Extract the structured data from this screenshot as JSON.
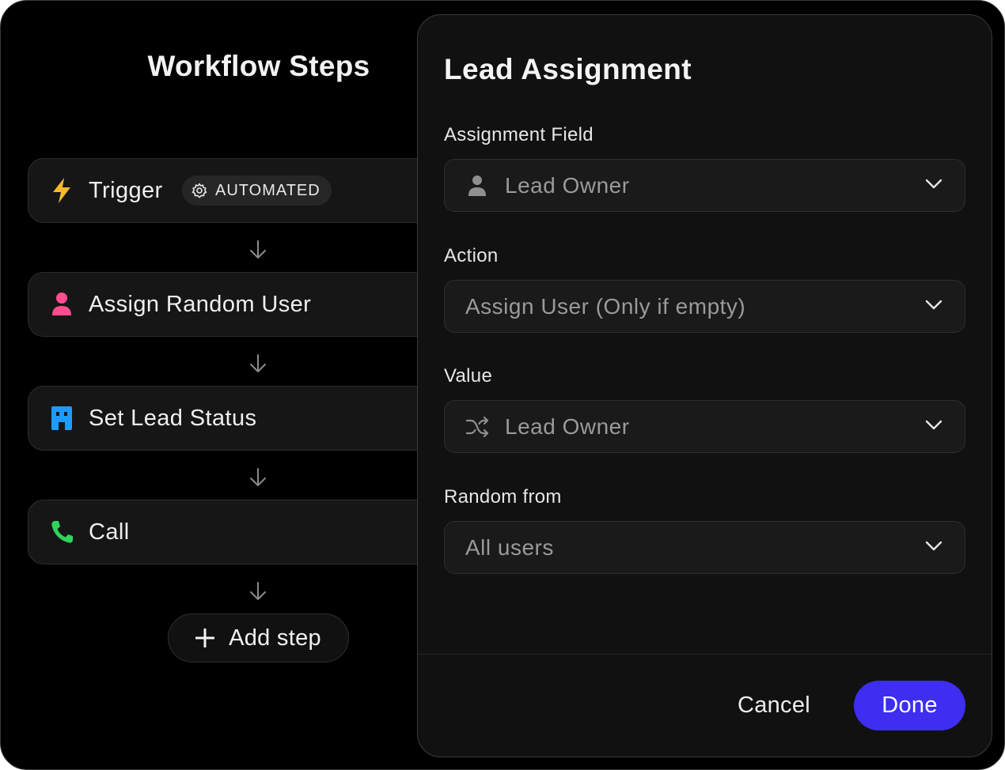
{
  "workflow": {
    "title": "Workflow Steps",
    "steps": [
      {
        "label": "Trigger",
        "icon": "lightning-icon",
        "badge": "AUTOMATED",
        "badge_icon": "gear-icon",
        "icon_color": "#f5b82e"
      },
      {
        "label": "Assign Random User",
        "icon": "user-icon",
        "icon_color": "#ff4d8f"
      },
      {
        "label": "Set Lead Status",
        "icon": "building-icon",
        "icon_color": "#1e9bff"
      },
      {
        "label": "Call",
        "icon": "phone-icon",
        "icon_color": "#2fd45a"
      }
    ],
    "add_step_label": "Add step"
  },
  "panel": {
    "title": "Lead Assignment",
    "fields": [
      {
        "label": "Assignment Field",
        "value": "Lead Owner",
        "icon": "user-icon"
      },
      {
        "label": "Action",
        "value": "Assign User (Only if empty)"
      },
      {
        "label": "Value",
        "value": "Lead Owner",
        "icon": "shuffle-icon"
      },
      {
        "label": "Random from",
        "value": "All users"
      }
    ],
    "cancel_label": "Cancel",
    "done_label": "Done"
  },
  "colors": {
    "accent": "#3d2ef0",
    "background": "#000000",
    "panel": "#111111"
  }
}
